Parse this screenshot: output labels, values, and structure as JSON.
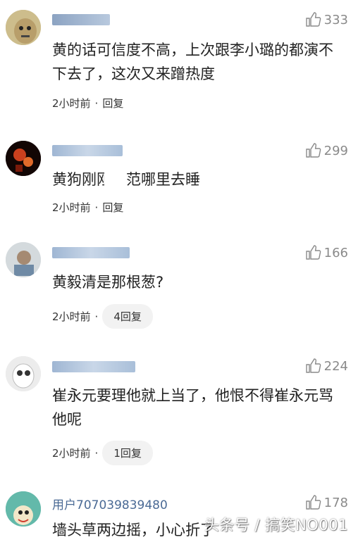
{
  "comments": [
    {
      "username": "",
      "like_count": "333",
      "content": "黄的话可信度不高，上次跟李小璐的都演不下去了，这次又来蹭热度",
      "time": "2小时前",
      "separator": "·",
      "reply_label": "回复"
    },
    {
      "username": "",
      "like_count": "299",
      "content": "黄狗刚刚到范哪里去睡",
      "time": "2小时前",
      "separator": "·",
      "reply_label": "回复"
    },
    {
      "username": "",
      "like_count": "166",
      "content": "黄毅清是那根葱?",
      "time": "2小时前",
      "separator": "·",
      "reply_label": "4回复"
    },
    {
      "username": "",
      "like_count": "224",
      "content": "崔永元要理他就上当了，他恨不得崔永元骂他呢",
      "time": "2小时前",
      "separator": "·",
      "reply_label": "1回复"
    },
    {
      "username": "用户707039839480",
      "like_count": "178",
      "content": "墙头草两边摇，小心折了"
    }
  ],
  "watermark": "头条号 / 搞笑NO001",
  "colors": {
    "username": "#4a6a95",
    "like": "#8a8a8a",
    "pill": "#f2f2f2"
  }
}
